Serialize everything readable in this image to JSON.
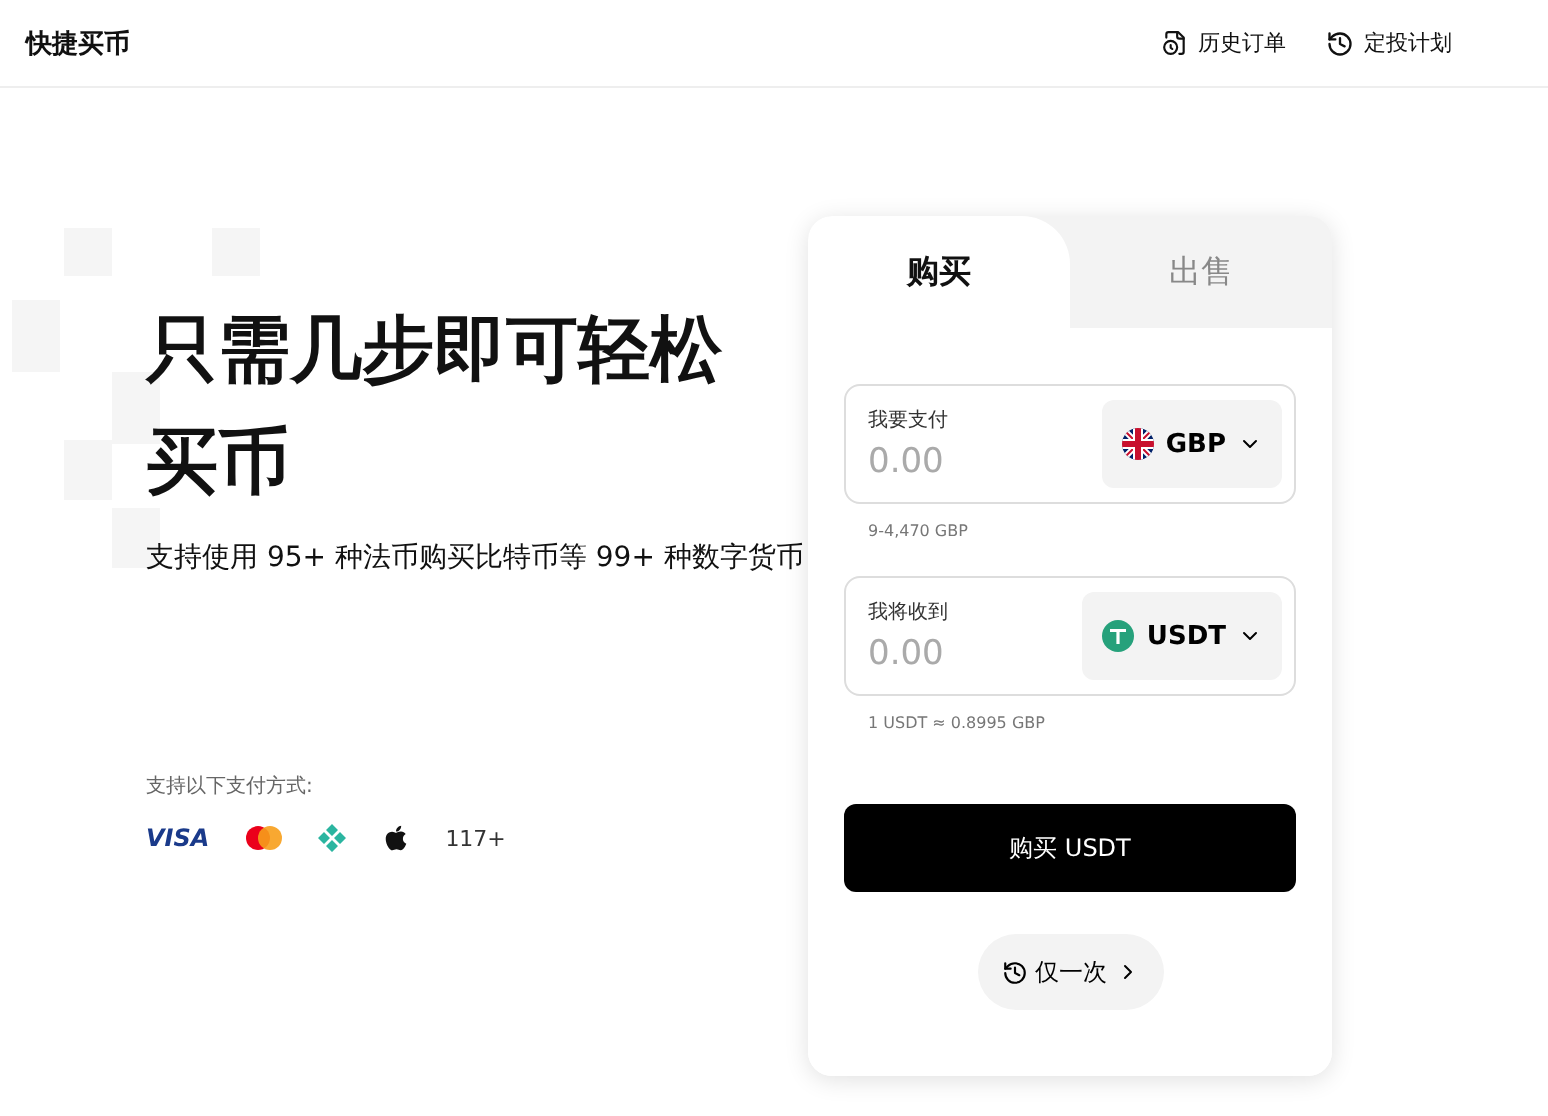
{
  "header": {
    "title": "快捷买币",
    "links": [
      {
        "label": "历史订单",
        "kind": "orders"
      },
      {
        "label": "定投计划",
        "kind": "schedule"
      }
    ]
  },
  "hero": {
    "title": "只需几步即可轻松买币",
    "subtitle": "支持使用 95+ 种法币购买比特币等 99+ 种数字货币",
    "payments_label": "支持以下支付方式:",
    "payments": [
      {
        "kind": "visa",
        "label": "VISA"
      },
      {
        "kind": "mastercard"
      },
      {
        "kind": "diamond"
      },
      {
        "kind": "apple"
      },
      {
        "kind": "more",
        "label": "117+"
      }
    ]
  },
  "card": {
    "tabs": [
      {
        "label": "购买",
        "selected": true
      },
      {
        "label": "出售",
        "selected": false
      }
    ],
    "fields": [
      {
        "label": "我要支付",
        "placeholder": "0.00",
        "currency": "GBP",
        "kind": "flag",
        "hint": "9-4,470 GBP"
      },
      {
        "label": "我将收到",
        "placeholder": "0.00",
        "currency": "USDT",
        "kind": "token",
        "hint": "1 USDT ≈ 0.8995 GBP"
      }
    ],
    "submit": "购买 USDT",
    "frequency": "仅一次"
  }
}
